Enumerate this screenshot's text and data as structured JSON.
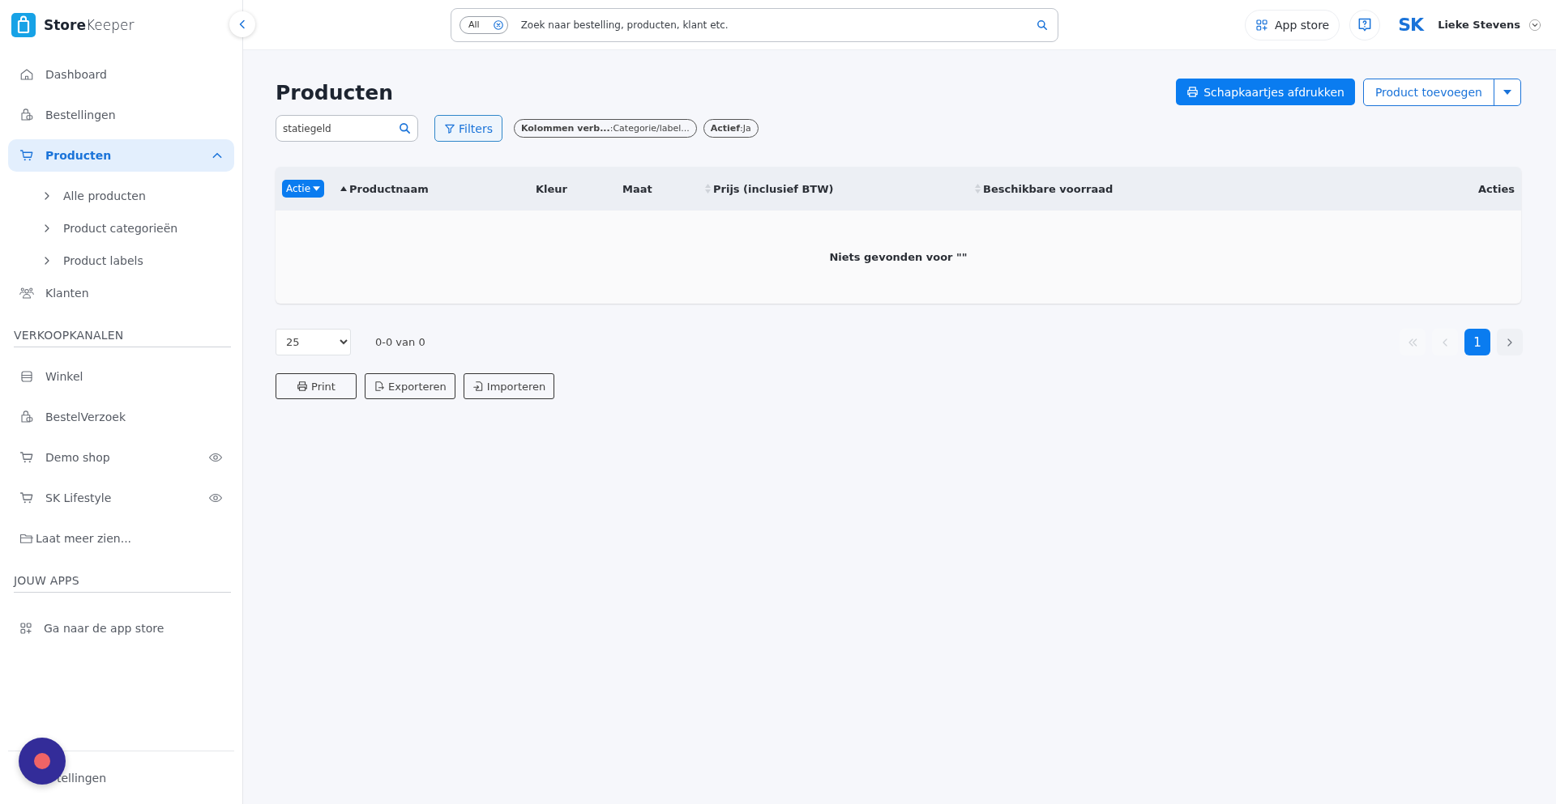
{
  "brand": {
    "name_bold": "Store",
    "name_light": "Keeper"
  },
  "sidebar": {
    "nav": [
      {
        "label": "Dashboard",
        "selected": false
      },
      {
        "label": "Bestellingen",
        "selected": false
      },
      {
        "label": "Producten",
        "selected": true,
        "expanded": true,
        "children": [
          {
            "label": "Alle producten"
          },
          {
            "label": "Product categorieën"
          },
          {
            "label": "Product labels"
          }
        ]
      },
      {
        "label": "Klanten",
        "selected": false
      }
    ],
    "sections": [
      {
        "heading": "VERKOOPKANALEN",
        "items": [
          {
            "label": "Winkel",
            "kind": "shop"
          },
          {
            "label": "BestelVerzoek",
            "kind": "request"
          },
          {
            "label": "Demo shop",
            "kind": "webshop"
          },
          {
            "label": "SK Lifestyle",
            "kind": "webshop"
          },
          {
            "label": "Laat meer zien...",
            "kind": "more"
          }
        ]
      },
      {
        "heading": "JOUW APPS",
        "items": [
          {
            "label": "Ga naar de app store",
            "kind": "apps"
          }
        ]
      }
    ],
    "footer_item": "tellingen"
  },
  "topbar": {
    "search": {
      "scope": "All",
      "placeholder": "Zoek naar bestelling, producten, klant etc."
    },
    "app_store": "App store",
    "logo": "SK",
    "user": "Lieke Stevens"
  },
  "page": {
    "title": "Producten",
    "print_labels_button": "Schapkaartjes afdrukken",
    "add_button": "Product toevoegen",
    "search_value": "statiegeld",
    "filters_button": "Filters",
    "chips": [
      {
        "key": "Kolommen verb...",
        "value": ":Categorie/label..."
      },
      {
        "key": "Actief",
        "value": ":Ja"
      }
    ]
  },
  "table": {
    "action_button": "Actie",
    "columns": [
      {
        "label": "Productnaam",
        "sorted": true,
        "sortable": true
      },
      {
        "label": "Kleur",
        "sorted": false,
        "sortable": false
      },
      {
        "label": "Maat",
        "sorted": false,
        "sortable": false
      },
      {
        "label": "Prijs (inclusief BTW)",
        "sorted": false,
        "sortable": true
      },
      {
        "label": "Beschikbare voorraad",
        "sorted": false,
        "sortable": true
      },
      {
        "label": "Acties",
        "sorted": false,
        "sortable": false
      }
    ],
    "empty_message": "Niets gevonden voor \"\""
  },
  "pagination": {
    "page_size": "25",
    "range": "0-0 van 0",
    "buttons": [
      {
        "kind": "first",
        "disabled": true
      },
      {
        "kind": "prev",
        "disabled": true
      },
      {
        "kind": "page",
        "label": "1",
        "selected": true
      },
      {
        "kind": "next",
        "disabled": false
      }
    ]
  },
  "bottom_buttons": [
    {
      "kind": "print",
      "label": "Print"
    },
    {
      "kind": "export",
      "label": "Exporteren"
    },
    {
      "kind": "import",
      "label": "Importeren"
    }
  ]
}
